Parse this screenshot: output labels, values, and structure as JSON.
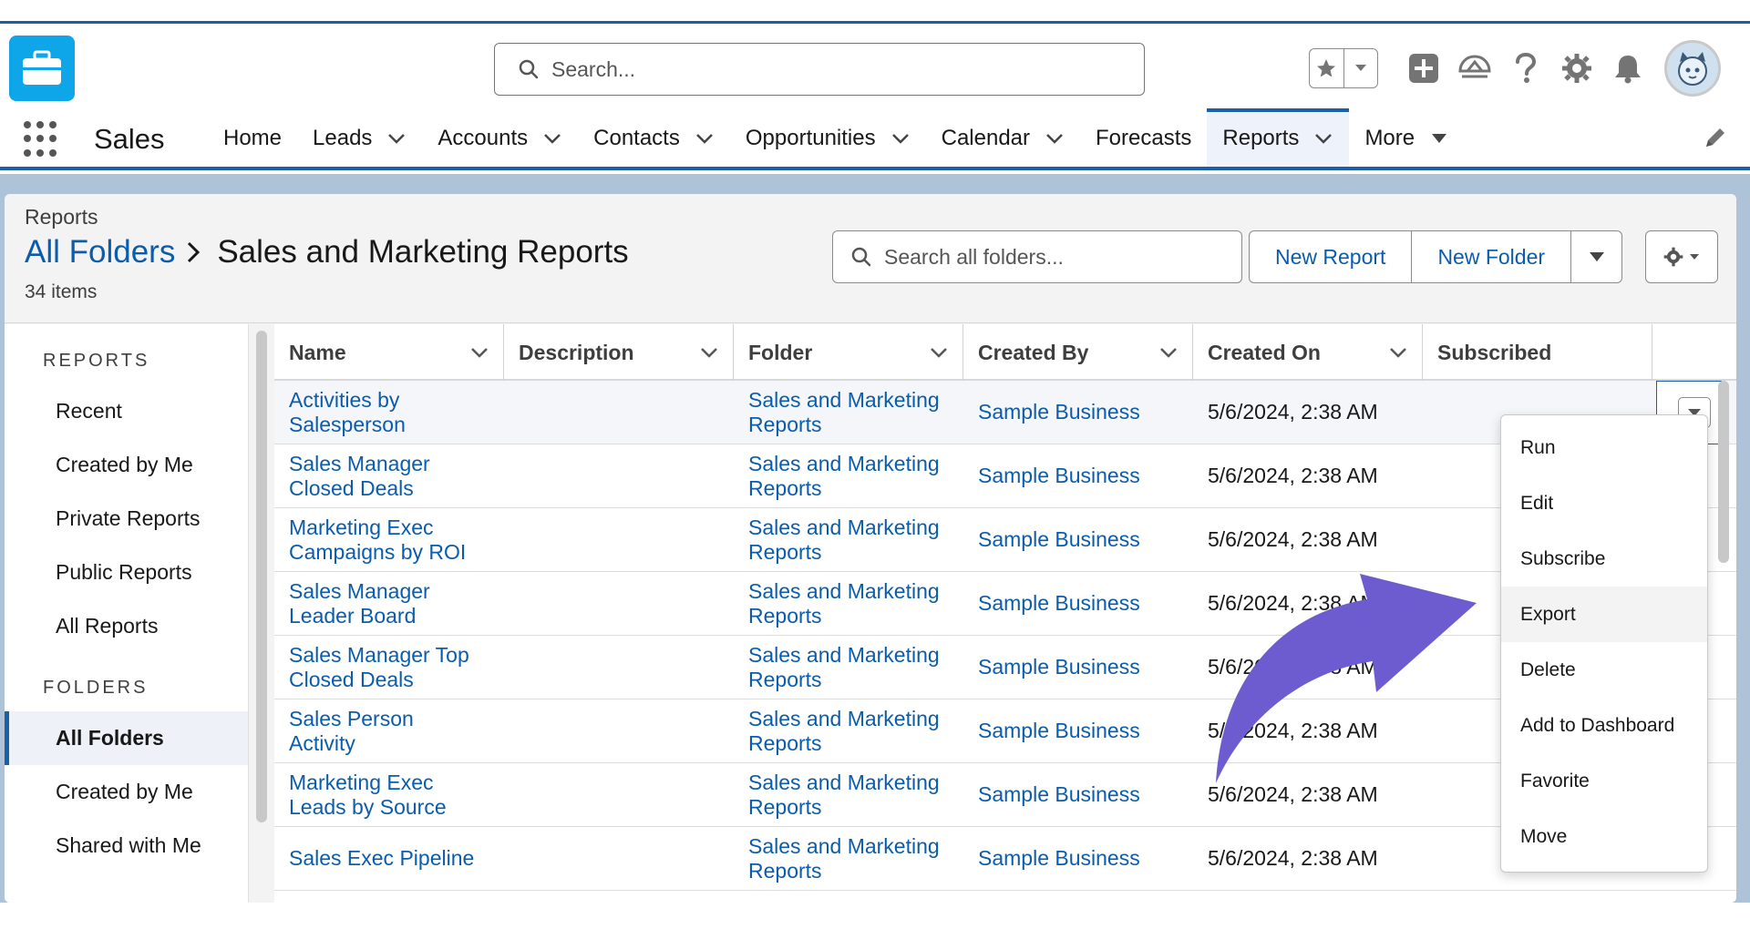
{
  "header": {
    "search_placeholder": "Search...",
    "icons": [
      "favorites-star-icon",
      "favorites-dropdown-icon",
      "global-add-icon",
      "trailhead-icon",
      "help-icon",
      "setup-gear-icon",
      "notifications-bell-icon",
      "user-avatar"
    ]
  },
  "nav": {
    "app_name": "Sales",
    "items": [
      {
        "label": "Home",
        "has_menu": false
      },
      {
        "label": "Leads",
        "has_menu": true
      },
      {
        "label": "Accounts",
        "has_menu": true
      },
      {
        "label": "Contacts",
        "has_menu": true
      },
      {
        "label": "Opportunities",
        "has_menu": true
      },
      {
        "label": "Calendar",
        "has_menu": true
      },
      {
        "label": "Forecasts",
        "has_menu": false
      },
      {
        "label": "Reports",
        "has_menu": true,
        "active": true
      },
      {
        "label": "More",
        "has_menu": true
      }
    ]
  },
  "page": {
    "object_label": "Reports",
    "breadcrumb_root": "All Folders",
    "breadcrumb_current": "Sales and Marketing Reports",
    "item_count": "34 items",
    "folder_search_placeholder": "Search all folders...",
    "new_report_label": "New Report",
    "new_folder_label": "New Folder"
  },
  "sidebar": {
    "reports_heading": "REPORTS",
    "reports_items": [
      "Recent",
      "Created by Me",
      "Private Reports",
      "Public Reports",
      "All Reports"
    ],
    "folders_heading": "FOLDERS",
    "folders_items": [
      "All Folders",
      "Created by Me",
      "Shared with Me"
    ],
    "active_folder": "All Folders"
  },
  "table": {
    "columns": [
      "Name",
      "Description",
      "Folder",
      "Created By",
      "Created On",
      "Subscribed"
    ],
    "rows": [
      {
        "name": [
          "Activities by",
          "Salesperson"
        ],
        "description": "",
        "folder": [
          "Sales and Marketing",
          "Reports"
        ],
        "created_by": "Sample Business",
        "created_on": "5/6/2024, 2:38 AM"
      },
      {
        "name": [
          "Sales Manager",
          "Closed Deals"
        ],
        "description": "",
        "folder": [
          "Sales and Marketing",
          "Reports"
        ],
        "created_by": "Sample Business",
        "created_on": "5/6/2024, 2:38 AM"
      },
      {
        "name": [
          "Marketing Exec",
          "Campaigns by ROI"
        ],
        "description": "",
        "folder": [
          "Sales and Marketing",
          "Reports"
        ],
        "created_by": "Sample Business",
        "created_on": "5/6/2024, 2:38 AM"
      },
      {
        "name": [
          "Sales Manager",
          "Leader Board"
        ],
        "description": "",
        "folder": [
          "Sales and Marketing",
          "Reports"
        ],
        "created_by": "Sample Business",
        "created_on": "5/6/2024, 2:38 AM"
      },
      {
        "name": [
          "Sales Manager Top",
          "Closed Deals"
        ],
        "description": "",
        "folder": [
          "Sales and Marketing",
          "Reports"
        ],
        "created_by": "Sample Business",
        "created_on": "5/6/2024, 2:38 AM"
      },
      {
        "name": [
          "Sales Person",
          "Activity"
        ],
        "description": "",
        "folder": [
          "Sales and Marketing",
          "Reports"
        ],
        "created_by": "Sample Business",
        "created_on": "5/6/2024, 2:38 AM"
      },
      {
        "name": [
          "Marketing Exec",
          "Leads by Source"
        ],
        "description": "",
        "folder": [
          "Sales and Marketing",
          "Reports"
        ],
        "created_by": "Sample Business",
        "created_on": "5/6/2024, 2:38 AM"
      },
      {
        "name": [
          "Sales Exec Pipeline"
        ],
        "description": "",
        "folder": [
          "Sales and Marketing",
          "Reports"
        ],
        "created_by": "Sample Business",
        "created_on": "5/6/2024, 2:38 AM"
      }
    ]
  },
  "row_menu": {
    "items": [
      "Run",
      "Edit",
      "Subscribe",
      "Export",
      "Delete",
      "Add to Dashboard",
      "Favorite",
      "Move"
    ],
    "highlighted": "Export"
  },
  "colors": {
    "brand_blue": "#1b5fa8",
    "link_blue": "#0b5cab",
    "annotation_arrow": "#6c5ccf",
    "logo_blue": "#0ea5e9"
  }
}
